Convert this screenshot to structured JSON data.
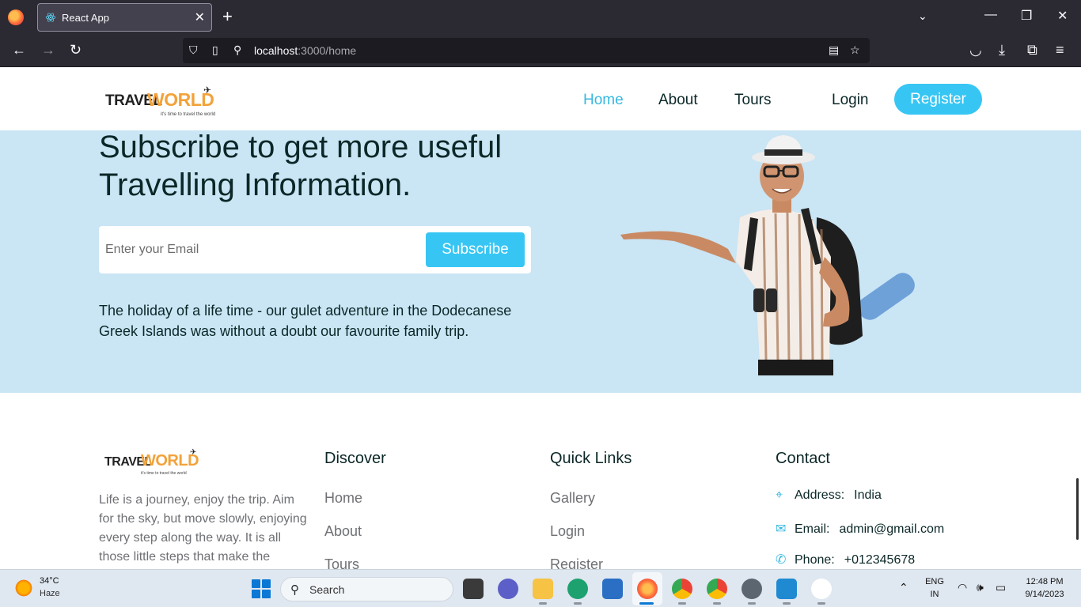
{
  "browser": {
    "tab_title": "React App",
    "url_host": "localhost",
    "url_path": ":3000/home",
    "icons": [
      "firefox-logo",
      "react-icon",
      "close-icon",
      "plus-icon",
      "chevron-down-icon",
      "minimize-icon",
      "restore-icon",
      "window-close-icon",
      "back-icon",
      "forward-icon",
      "reload-icon",
      "shield-icon",
      "page-icon",
      "permissions-icon",
      "reader-view-icon",
      "bookmark-star-icon",
      "pocket-icon",
      "download-icon",
      "extensions-icon",
      "menu-icon"
    ]
  },
  "header": {
    "logo_word1": "TRAVEL",
    "logo_word2": "WORLD",
    "logo_tagline": "it's time to travel the world",
    "nav": [
      "Home",
      "About",
      "Tours"
    ],
    "login": "Login",
    "register": "Register"
  },
  "newsletter": {
    "title": "Subscribe to get more useful Travelling Information.",
    "email_placeholder": "Enter your Email",
    "subscribe_label": "Subscribe",
    "description": "The holiday of a life time - our gulet adventure in the Dodecanese Greek Islands was without a doubt our favourite family trip."
  },
  "footer": {
    "about": "Life is a journey, enjoy the trip. Aim for the sky, but move slowly, enjoying every step along the way. It is all those little steps that make the",
    "discover": {
      "title": "Discover",
      "links": [
        "Home",
        "About",
        "Tours"
      ]
    },
    "quick_links": {
      "title": "Quick Links",
      "links": [
        "Gallery",
        "Login",
        "Register"
      ]
    },
    "contact": {
      "title": "Contact",
      "address_label": "Address:",
      "address": "India",
      "email_label": "Email:",
      "email": "admin@gmail.com",
      "phone_label": "Phone:",
      "phone": "+012345678"
    }
  },
  "taskbar": {
    "temperature": "34°C",
    "weather": "Haze",
    "search": "Search",
    "lang1": "ENG",
    "lang2": "IN",
    "time": "12:48 PM",
    "date": "9/14/2023"
  },
  "colors": {
    "accent": "#37c6f4",
    "newsletter_bg": "#cae5f4",
    "logo_orange": "#f2a23a",
    "heading": "#0b2727"
  }
}
